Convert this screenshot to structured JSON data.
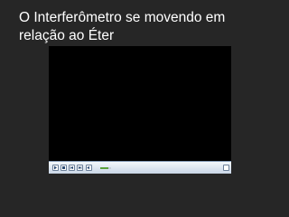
{
  "slide": {
    "title": "O Interferômetro se movendo em relação ao Éter"
  },
  "player": {
    "volume_fraction": 0.75,
    "controls": [
      {
        "name": "play-icon"
      },
      {
        "name": "stop-icon"
      },
      {
        "name": "previous-icon"
      },
      {
        "name": "next-icon"
      },
      {
        "name": "mute-icon"
      }
    ],
    "colors": {
      "background": "#262626",
      "video": "#000000",
      "control_bar_top": "#f4f8fc",
      "control_bar_bottom": "#c9d6e6",
      "volume": "#5aa03c"
    }
  }
}
